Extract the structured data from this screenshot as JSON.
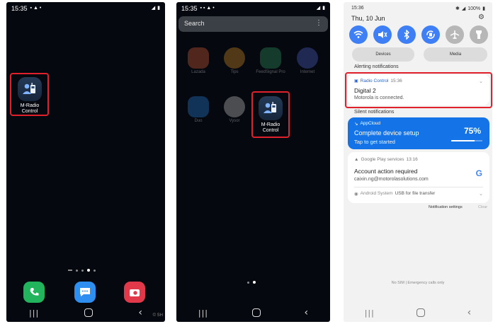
{
  "screens": {
    "home": {
      "status_time": "15:35",
      "app_label": "M-Radio Control",
      "watermark": "© SH"
    },
    "drawer": {
      "status_time": "15:35",
      "search_placeholder": "Search",
      "ghost_apps": [
        {
          "label": "Lazada",
          "color": "#f0663a"
        },
        {
          "label": "Tips",
          "color": "#f0a12a"
        },
        {
          "label": "FeedSignal Pro",
          "color": "#35a86a"
        },
        {
          "label": "Internet",
          "color": "#5a6ee0"
        },
        {
          "label": "Duo",
          "color": "#2a8ef0"
        },
        {
          "label": "Vysor",
          "color": "#dddddd"
        }
      ],
      "app_label": "M-Radio Control"
    },
    "notifications": {
      "status_time": "15:36",
      "status_right": "100%",
      "date": "Thu, 10 Jun",
      "pill_devices": "Devices",
      "pill_media": "Media",
      "alerting_label": "Alerting notifications",
      "radio_notif": {
        "app": "Radio Control",
        "time": "15:36",
        "title": "Digital 2",
        "body": "Motorola is connected."
      },
      "silent_label": "Silent notifications",
      "appcloud": {
        "app": "AppCloud",
        "title": "Complete device setup",
        "subtitle": "Tap to get started",
        "percent": "75%",
        "progress": 0.75
      },
      "play_notif": {
        "app": "Google Play services",
        "time": "13:16",
        "title": "Account action required",
        "body": "caixin.ng@motorolasolutions.com"
      },
      "system_notif": {
        "app": "Android System",
        "text": "USB for file transfer"
      },
      "settings_label": "Notification settings",
      "clear_label": "Clear",
      "footer": "No SIM | Emergency calls only"
    }
  },
  "colors": {
    "highlight": "#e0202a",
    "accent_blue": "#3e7ff5",
    "appcloud_blue": "#1473e6"
  }
}
